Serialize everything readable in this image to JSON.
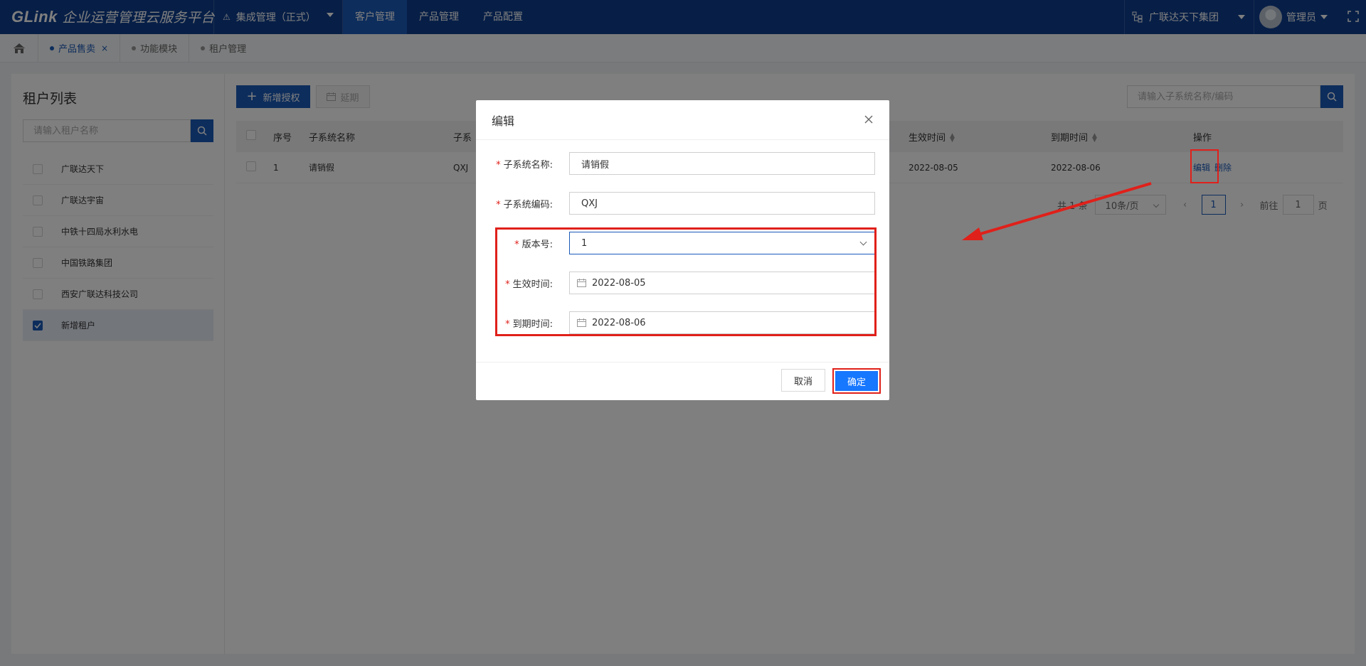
{
  "header": {
    "brand_logo": "GLink",
    "brand_title": "企业运营管理云服务平台",
    "system": "集成管理（正式）",
    "nav": [
      "客户管理",
      "产品管理",
      "产品配置"
    ],
    "org": "广联达天下集团",
    "user": "管理员"
  },
  "tabs": [
    {
      "label": "产品售卖",
      "close": "×"
    },
    {
      "label": "功能模块"
    },
    {
      "label": "租户管理"
    }
  ],
  "left": {
    "title": "租户列表",
    "search_placeholder": "请输入租户名称",
    "tenants": [
      "广联达天下",
      "广联达宇宙",
      "中铁十四局水利水电",
      "中国铁路集团",
      "西安广联达科技公司",
      "新增租户"
    ]
  },
  "main": {
    "add_button": "新增授权",
    "extend_button": "延期",
    "search_placeholder": "请输入子系统名称/编码",
    "columns": [
      "序号",
      "子系统名称",
      "子系",
      "生效时间",
      "到期时间",
      "操作"
    ],
    "row": {
      "index": "1",
      "name": "请销假",
      "code": "QXJ",
      "start": "2022-08-05",
      "end": "2022-08-06",
      "edit": "编辑",
      "delete": "删除"
    },
    "pager": {
      "total": "共 1 条",
      "size": "10条/页",
      "page": "1",
      "goto_prefix": "前往",
      "goto_value": "1",
      "goto_suffix": "页"
    }
  },
  "dialog": {
    "title": "编辑",
    "fields": [
      {
        "label": "子系统名称:",
        "value": "请销假"
      },
      {
        "label": "子系统编码:",
        "value": "QXJ"
      },
      {
        "label": "版本号:",
        "value": "1"
      },
      {
        "label": "生效时间:",
        "value": "2022-08-05"
      },
      {
        "label": "到期时间:",
        "value": "2022-08-06"
      }
    ],
    "required_mark": "*",
    "cancel": "取消",
    "ok": "确定"
  },
  "colors": {
    "header": "#0f3e8f",
    "primary": "#1b5ab8",
    "annotation": "#e0201a"
  }
}
